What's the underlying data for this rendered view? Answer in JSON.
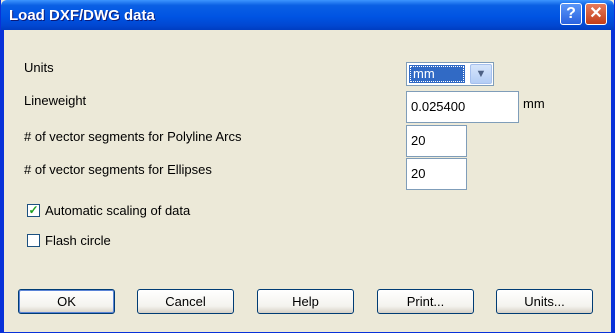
{
  "window": {
    "title": "Load DXF/DWG data",
    "help_glyph": "?",
    "close_glyph": "✕"
  },
  "form": {
    "units_label": "Units",
    "units_value": "mm",
    "lineweight_label": "Lineweight",
    "lineweight_value": "0.025400",
    "lineweight_unit": "mm",
    "polyline_arcs_label": "# of vector segments for Polyline Arcs",
    "polyline_arcs_value": "20",
    "ellipses_label": "# of vector segments for Ellipses",
    "ellipses_value": "20",
    "auto_scale_label": "Automatic scaling of data",
    "auto_scale_checked": true,
    "flash_circle_label": "Flash circle",
    "flash_circle_checked": false
  },
  "buttons": {
    "ok": "OK",
    "cancel": "Cancel",
    "help": "Help",
    "print": "Print...",
    "units": "Units..."
  },
  "icons": {
    "dropdown": "chevron-down-icon",
    "check": "checkmark-icon"
  }
}
